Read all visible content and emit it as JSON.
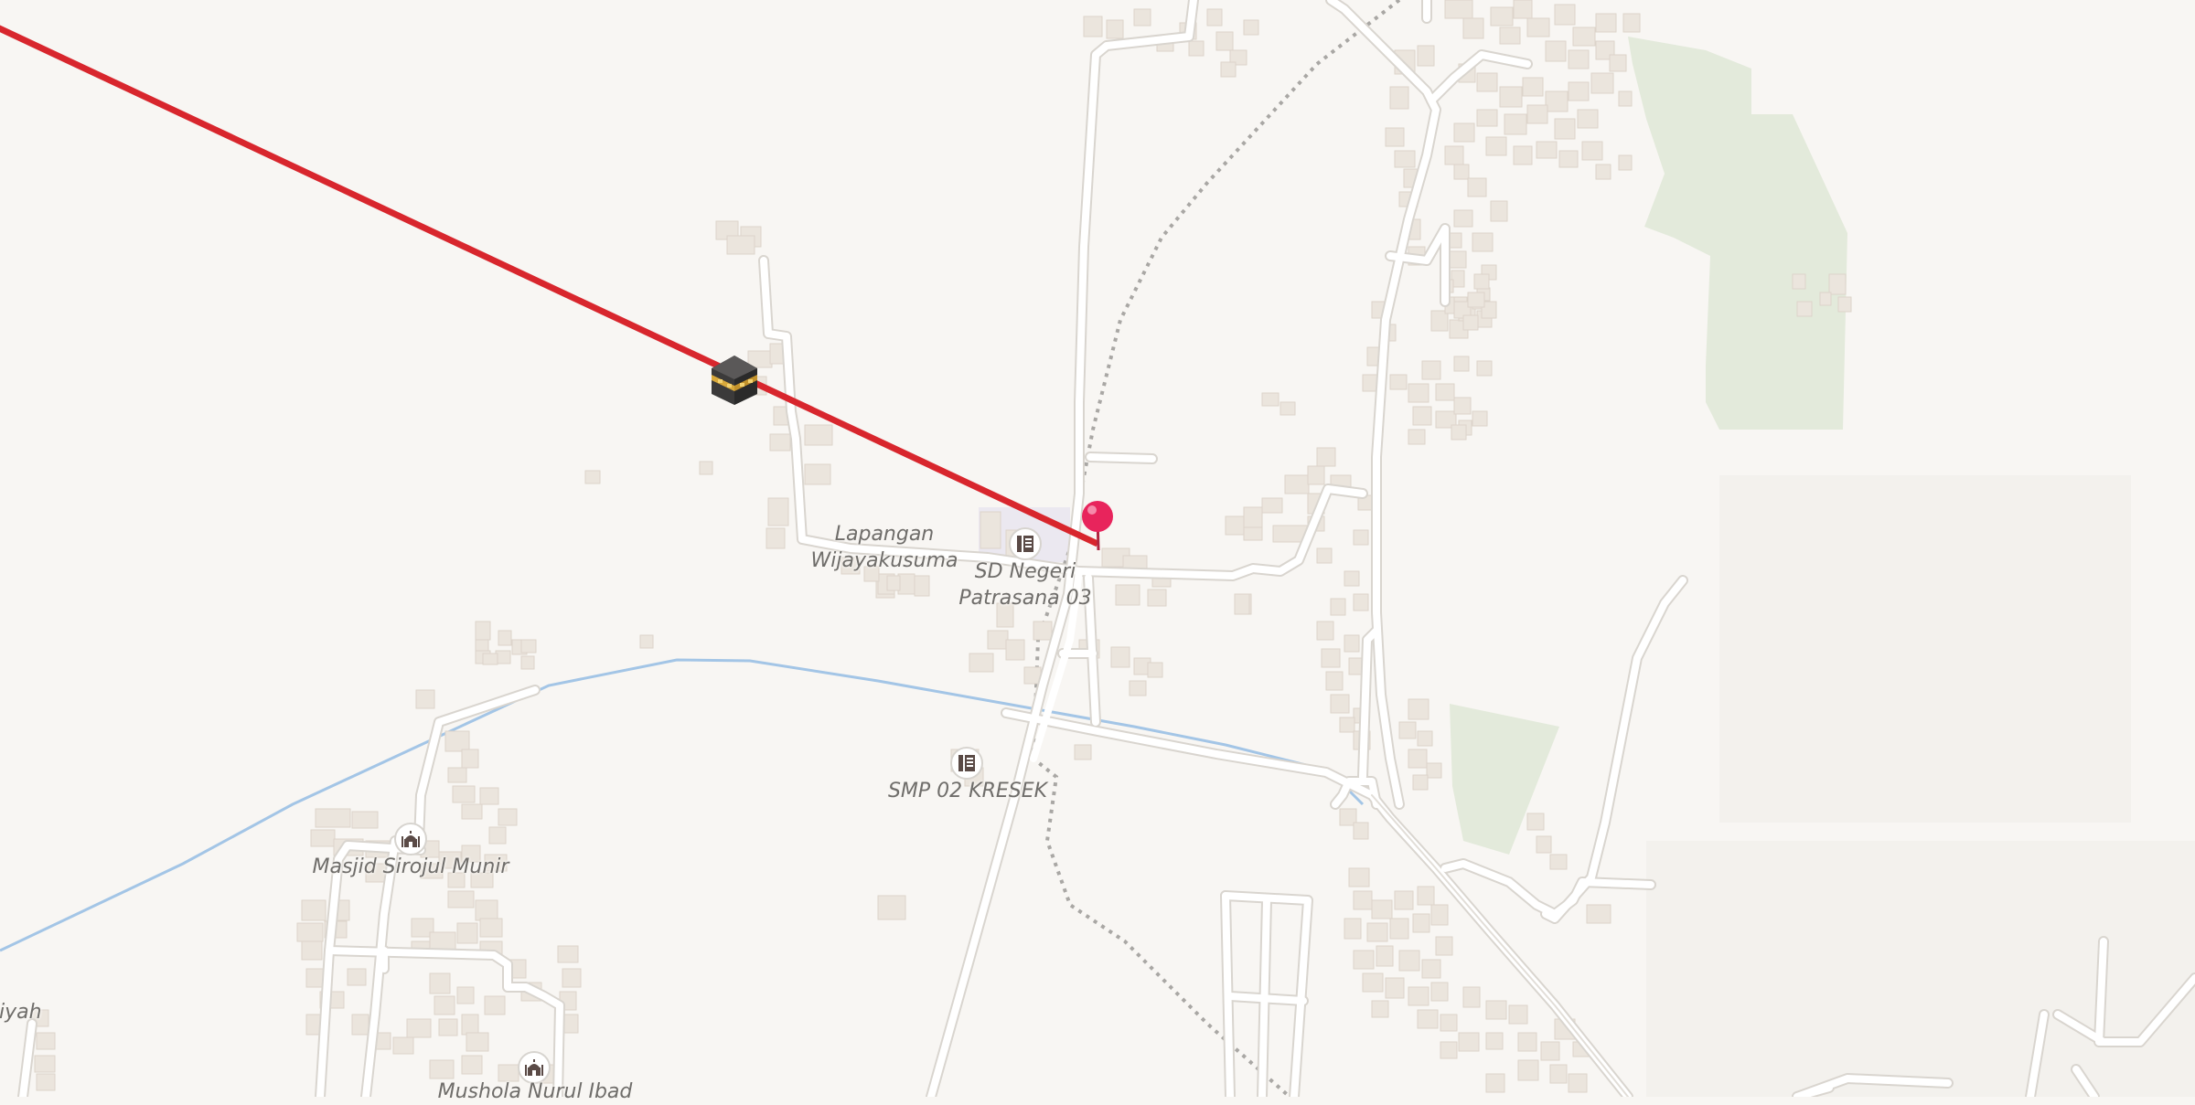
{
  "map": {
    "labels": {
      "field": "Lapangan\nWijayakusuma",
      "school_sd": "SD Negeri\nPatrasana 03",
      "school_smp": "SMP 02 KRESEK",
      "mosque_1": "Masjid Sirojul Munir",
      "mosque_2": "Mushola Nurul Ibad",
      "cut_left": "tiyah"
    },
    "icons": {
      "kaaba": "kaaba-icon",
      "pin": "location-pin-icon",
      "school": "school-icon",
      "mosque": "mosque-icon"
    },
    "colors": {
      "background": "#f8f6f3",
      "road": "#ffffff",
      "road_casing": "#dcd8d2",
      "building": "#ece6df",
      "river": "#a8c8e8",
      "park": "#e4ebdc",
      "qibla_line": "#d8262d",
      "pin": "#e8245c",
      "path": "#a8a6a3"
    }
  }
}
